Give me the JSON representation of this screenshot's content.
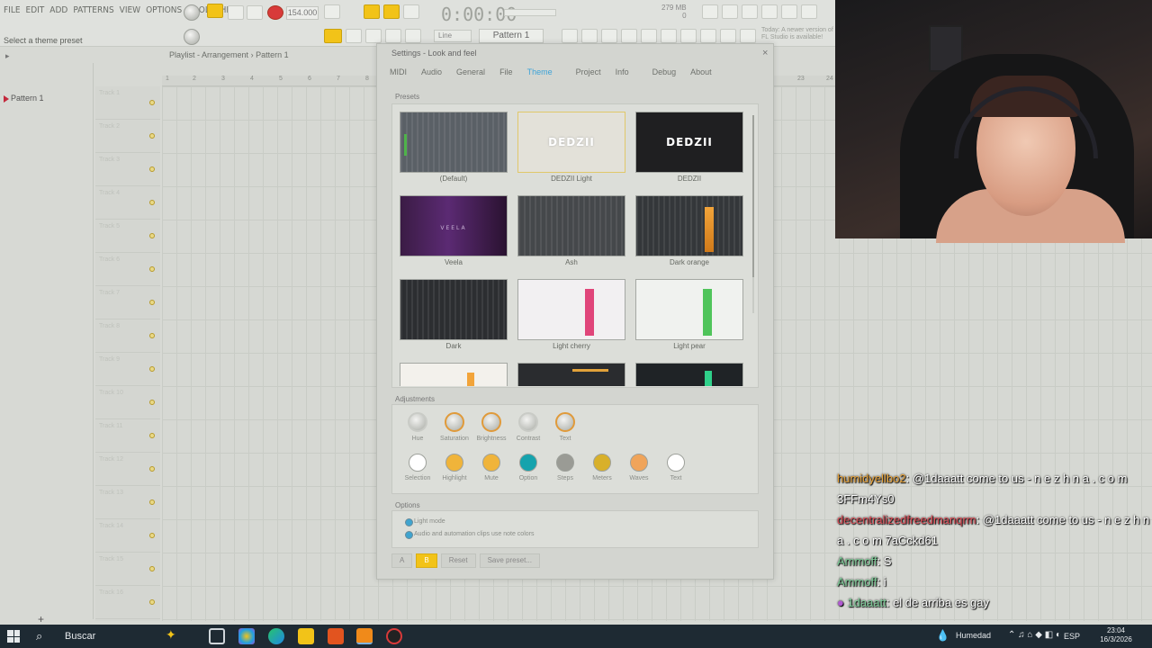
{
  "menu": [
    "FILE",
    "EDIT",
    "ADD",
    "PATTERNS",
    "VIEW",
    "OPTIONS",
    "TOOLS",
    "HELP"
  ],
  "hint": "Select a theme preset",
  "toolbar": {
    "tempo": "154.000",
    "time": "0:00:00",
    "pattern": "Pattern 1",
    "snap": "Line",
    "memory": "279 MB",
    "mem_count": "0",
    "news": "Today: A newer version of FL Studio is available!"
  },
  "playlist": {
    "title": "Playlist - Arrangement",
    "crumb": "Pattern 1",
    "ruler": [
      "1",
      "2",
      "3",
      "4",
      "5",
      "6",
      "7",
      "8",
      "23",
      "24"
    ]
  },
  "browser": {
    "item": "Pattern 1"
  },
  "tracks": [
    "Track 1",
    "Track 2",
    "Track 3",
    "Track 4",
    "Track 5",
    "Track 6",
    "Track 7",
    "Track 8",
    "Track 9",
    "Track 10",
    "Track 11",
    "Track 12",
    "Track 13",
    "Track 14",
    "Track 15",
    "Track 16"
  ],
  "settings": {
    "title": "Settings - Look and feel",
    "tabs": [
      "MIDI",
      "Audio",
      "General",
      "File",
      "Theme",
      "Project",
      "Info",
      "Debug",
      "About"
    ],
    "active_tab": "Theme",
    "presets_label": "Presets",
    "presets": [
      {
        "name": "(Default)",
        "logo": "",
        "style": "default"
      },
      {
        "name": "DEDZII Light",
        "logo": "DEDZII",
        "style": "light-logo"
      },
      {
        "name": "DEDZII",
        "logo": "DEDZII",
        "style": "dark-logo"
      },
      {
        "name": "Veela",
        "logo": "VEELA",
        "style": "purple"
      },
      {
        "name": "Ash",
        "logo": "",
        "style": "ash"
      },
      {
        "name": "Dark orange",
        "logo": "",
        "style": "dark-orange"
      },
      {
        "name": "Dark",
        "logo": "",
        "style": "dark"
      },
      {
        "name": "Light cherry",
        "logo": "",
        "style": "light-cherry"
      },
      {
        "name": "Light pear",
        "logo": "",
        "style": "light-pear"
      }
    ],
    "adjust_label": "Adjustments",
    "knobs": [
      "Hue",
      "Saturation",
      "Brightness",
      "Contrast",
      "Text"
    ],
    "swatches": [
      {
        "name": "Selection",
        "color": "#ffffff"
      },
      {
        "name": "Highlight",
        "color": "#f0b43a"
      },
      {
        "name": "Mute",
        "color": "#f0b43a"
      },
      {
        "name": "Option",
        "color": "#15a3ad"
      },
      {
        "name": "Steps",
        "color": "#9a9b95"
      },
      {
        "name": "Meters",
        "color": "#d8b02a"
      },
      {
        "name": "Waves",
        "color": "#f0a45a"
      },
      {
        "name": "Text",
        "color": "#ffffff"
      }
    ],
    "options_label": "Options",
    "options": [
      "Light mode",
      "Audio and automation clips use note colors"
    ],
    "footer": {
      "a": "A",
      "b": "B",
      "reset": "Reset",
      "save": "Save preset..."
    }
  },
  "chat": [
    {
      "user": "humidyellbo2",
      "text": ": @1daaatt come to us - n e z h n a . c o m 3FFm4Ys0"
    },
    {
      "user": "decentralizedfreedmanqrm",
      "text": ": @1daaatt come to us - n e z h n a . c o m 7aCckd61"
    },
    {
      "user": "Ammoff",
      "text": ": S"
    },
    {
      "user": "Ammoff",
      "text": ": i"
    },
    {
      "user": "1daaatt",
      "text": ": el de arriba es gay"
    }
  ],
  "taskbar": {
    "search": "Buscar",
    "weather": "Humedad",
    "lang": "ESP",
    "time": "23:04",
    "date": "16/3/2026"
  }
}
